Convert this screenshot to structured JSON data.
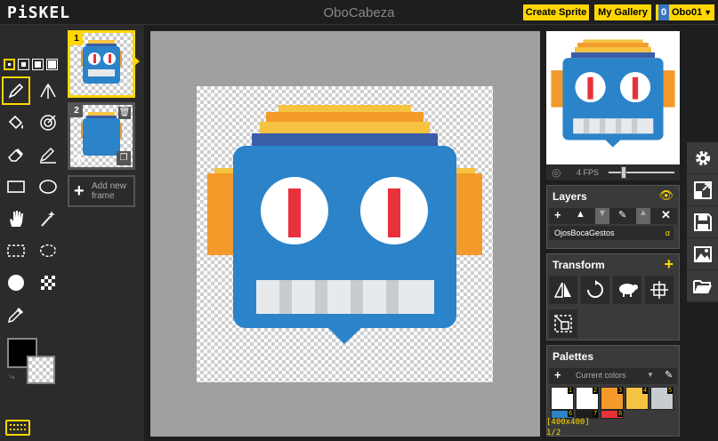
{
  "app": {
    "logo": "PiSKEL",
    "title": "OboCabeza"
  },
  "header": {
    "create_label": "Create Sprite",
    "gallery_label": "My Gallery",
    "user_badge": "0",
    "user_name": "Obo01"
  },
  "tools": {
    "pen_sizes": [
      1,
      2,
      3,
      4
    ],
    "items": [
      "pen-icon",
      "vertical-mirror-icon",
      "paint-bucket-icon",
      "colorswap-icon",
      "eraser-icon",
      "stroke-icon",
      "rectangle-icon",
      "circle-icon",
      "move-icon",
      "shape-select-icon",
      "rectangle-select-icon",
      "lasso-select-icon",
      "lighten-icon",
      "dithering-icon",
      "color-picker-icon"
    ],
    "primary_color": "#000000",
    "secondary_color": "transparent"
  },
  "frames": {
    "items": [
      {
        "number": "1"
      },
      {
        "number": "2"
      }
    ],
    "add_label": "Add new frame"
  },
  "animation": {
    "fps_label": "4 FPS",
    "fps": 4
  },
  "layers": {
    "title": "Layers",
    "items": [
      {
        "name": "OjosBocaGestos",
        "opacity": "α"
      }
    ]
  },
  "transform": {
    "title": "Transform"
  },
  "palettes": {
    "title": "Palettes",
    "selected": "Current colors",
    "swatches": [
      {
        "color": "#ffffff",
        "index": "1"
      },
      {
        "color": "#ffffff",
        "index": "2"
      },
      {
        "color": "#f39a2b",
        "index": "3"
      },
      {
        "color": "#f5c242",
        "index": "4"
      },
      {
        "color": "#c7ccd1",
        "index": "5"
      },
      {
        "color": "#2b83c9",
        "index": "6"
      },
      {
        "color": "#1d1d1d",
        "index": "7"
      },
      {
        "color": "#e8313a",
        "index": "8"
      }
    ]
  },
  "status": {
    "coords": "[400x400]",
    "page": "1/2"
  },
  "colors": {
    "accent": "#ffd700",
    "robot_blue": "#2b83c9",
    "robot_band": "#3b5ea8",
    "robot_ear": "#f39a2b",
    "robot_top": "#f5c242",
    "eye_red": "#e8313a",
    "teeth_gray": "#c7ccd1"
  }
}
